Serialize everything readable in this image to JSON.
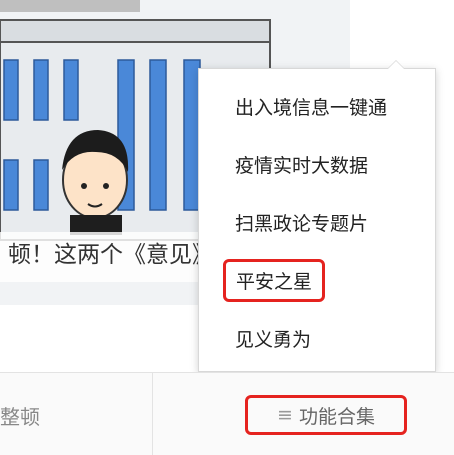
{
  "banner": {
    "caption": "顿！这两个《意见》"
  },
  "menu": {
    "items": [
      {
        "label": "出入境信息一键通"
      },
      {
        "label": "疫情实时大数据"
      },
      {
        "label": "扫黑政论专题片"
      },
      {
        "label": "平安之星"
      },
      {
        "label": "见义勇为"
      }
    ]
  },
  "bottom_bar": {
    "left_tab_label": "整顿",
    "right_tab_label": "功能合集",
    "right_tab_icon": "menu-icon"
  },
  "colors": {
    "highlight": "#e5231f",
    "building": "#4a88d8"
  }
}
